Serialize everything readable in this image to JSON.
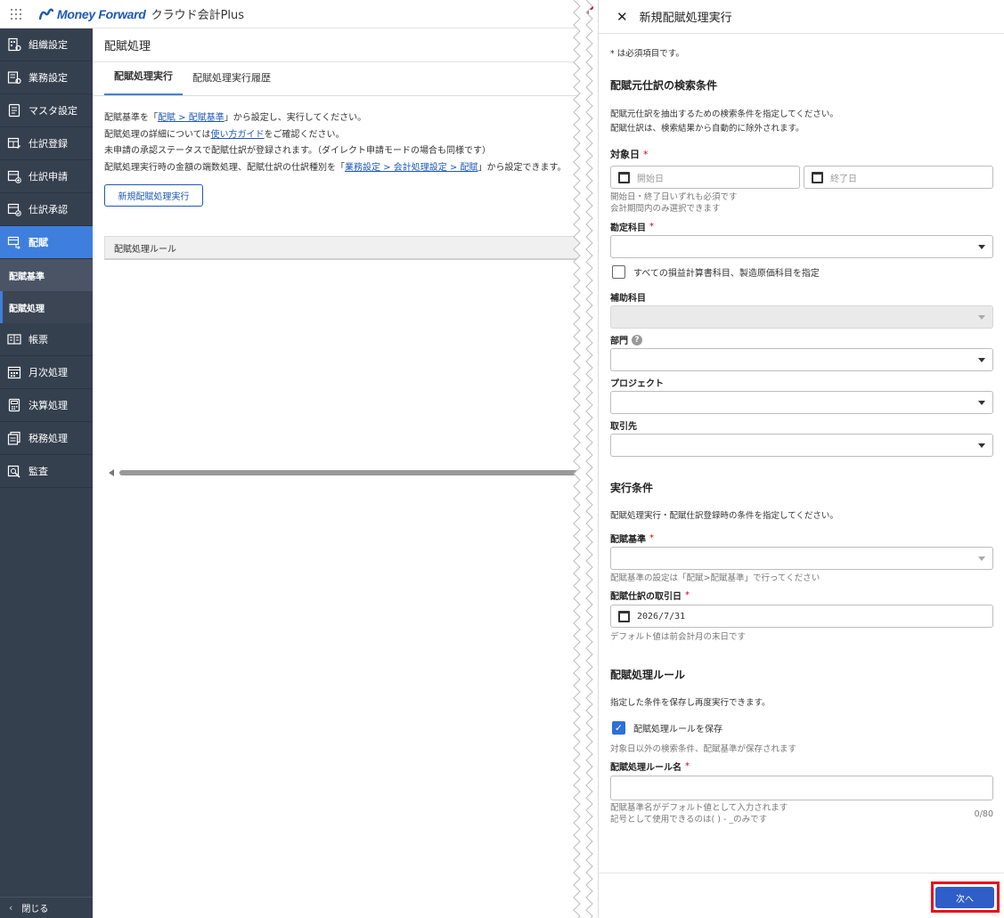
{
  "app": {
    "logo_brand": "Money Forward",
    "logo_product": "クラウド会計Plus"
  },
  "sidebar": {
    "items": [
      {
        "label": "組織設定",
        "icon": "org-settings-icon"
      },
      {
        "label": "業務設定",
        "icon": "business-settings-icon"
      },
      {
        "label": "マスタ設定",
        "icon": "master-settings-icon"
      },
      {
        "label": "仕訳登録",
        "icon": "journal-entry-icon"
      },
      {
        "label": "仕訳申請",
        "icon": "journal-request-icon"
      },
      {
        "label": "仕訳承認",
        "icon": "journal-approval-icon"
      },
      {
        "label": "配賦",
        "icon": "allocation-icon"
      },
      {
        "label": "帳票",
        "icon": "report-icon"
      },
      {
        "label": "月次処理",
        "icon": "monthly-icon"
      },
      {
        "label": "決算処理",
        "icon": "closing-icon"
      },
      {
        "label": "税務処理",
        "icon": "tax-icon"
      },
      {
        "label": "監査",
        "icon": "audit-icon"
      }
    ],
    "sub_items": [
      {
        "label": "配賦基準"
      },
      {
        "label": "配賦処理"
      }
    ],
    "close_label": "閉じる"
  },
  "main": {
    "title": "配賦処理",
    "tabs": [
      {
        "label": "配賦処理実行"
      },
      {
        "label": "配賦処理実行履歴"
      }
    ],
    "desc": {
      "line1_pre": "配賦基準を「",
      "line1_link": "配賦 > 配賦基準",
      "line1_post": "」から設定し、実行してください。",
      "line2_pre": "配賦処理の詳細については",
      "line2_link": "使い方ガイド",
      "line2_post": "をご確認ください。",
      "line3": "未申請の承認ステータスで配賦仕訳が登録されます。（ダイレクト申請モードの場合も同様です）",
      "line4_pre": "配賦処理実行時の金額の端数処理、配賦仕訳の仕訳種別を「",
      "line4_link": "業務設定 > 会計処理設定 > 配賦",
      "line4_post": "」から設定できます。"
    },
    "new_button": "新規配賦処理実行",
    "rule_header": "配賦処理ルール"
  },
  "panel": {
    "title": "新規配賦処理実行",
    "required_note": "* は必須項目です。",
    "search": {
      "heading": "配賦元仕訳の検索条件",
      "desc1": "配賦元仕訳を抽出するための検索条件を指定してください。",
      "desc2": "配賦仕訳は、検索結果から自動的に除外されます。",
      "target_date_label": "対象日",
      "start_placeholder": "開始日",
      "end_placeholder": "終了日",
      "date_hint1": "開始日・終了日いずれも必須です",
      "date_hint2": "会計期間内のみ選択できます",
      "account_label": "勘定科目",
      "all_accounts_label": "すべての損益計算書科目、製造原価科目を指定",
      "sub_account_label": "補助科目",
      "department_label": "部門",
      "project_label": "プロジェクト",
      "partner_label": "取引先"
    },
    "exec": {
      "heading": "実行条件",
      "desc": "配賦処理実行・配賦仕訳登録時の条件を指定してください。",
      "basis_label": "配賦基準",
      "basis_hint": "配賦基準の設定は「配賦>配賦基準」で行ってください",
      "txn_date_label": "配賦仕訳の取引日",
      "txn_date_value": "2026/7/31",
      "txn_date_hint": "デフォルト値は前会計月の末日です"
    },
    "rule": {
      "heading": "配賦処理ルール",
      "desc": "指定した条件を保存し再度実行できます。",
      "save_label": "配賦処理ルールを保存",
      "save_hint": "対象日以外の検索条件、配賦基準が保存されます",
      "name_label": "配賦処理ルール名",
      "name_hint1": "配賦基準名がデフォルト値として入力されます",
      "name_hint2": "記号として使用できるのは( ) - _のみです",
      "counter": "0/80"
    },
    "next_button": "次へ",
    "required_mark": "*",
    "check_mark": "✓",
    "help_mark": "?"
  }
}
